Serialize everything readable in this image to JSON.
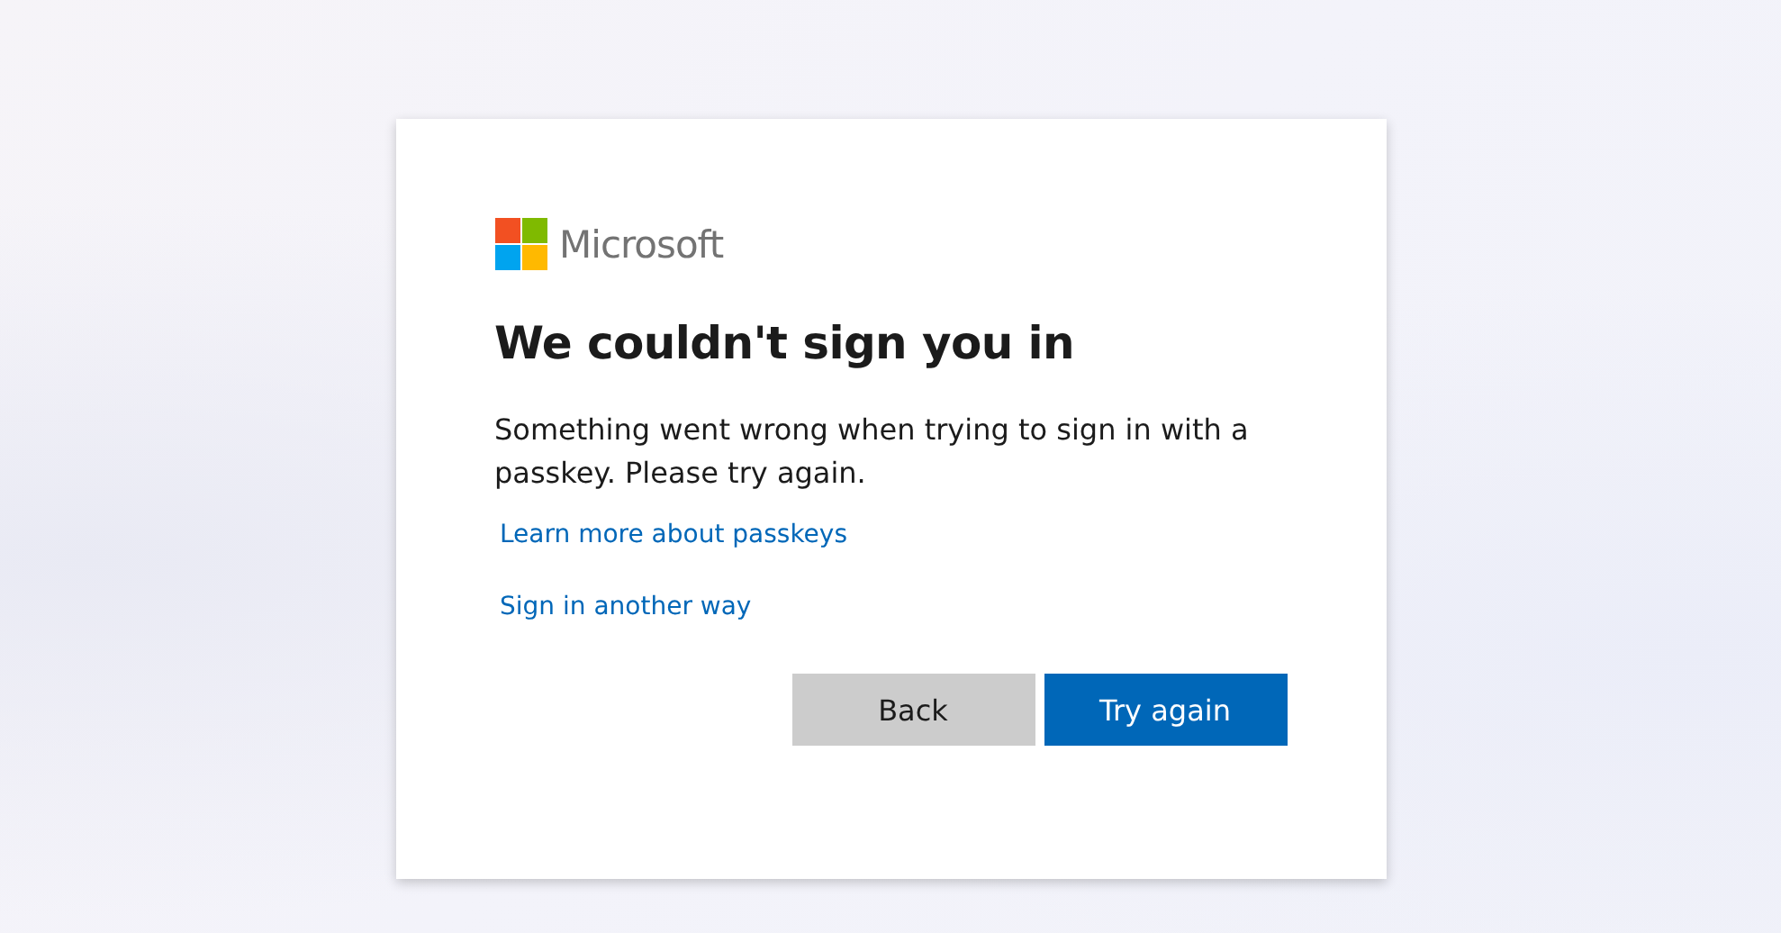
{
  "brand": {
    "name": "Microsoft"
  },
  "title": "We couldn't sign you in",
  "message": "Something went wrong when trying to sign in with a passkey. Please try again.",
  "links": [
    "Learn more about passkeys",
    "Sign in another way"
  ],
  "buttons": [
    {
      "label": "Back",
      "kind": "secondary"
    },
    {
      "label": "Try again",
      "kind": "primary"
    }
  ]
}
